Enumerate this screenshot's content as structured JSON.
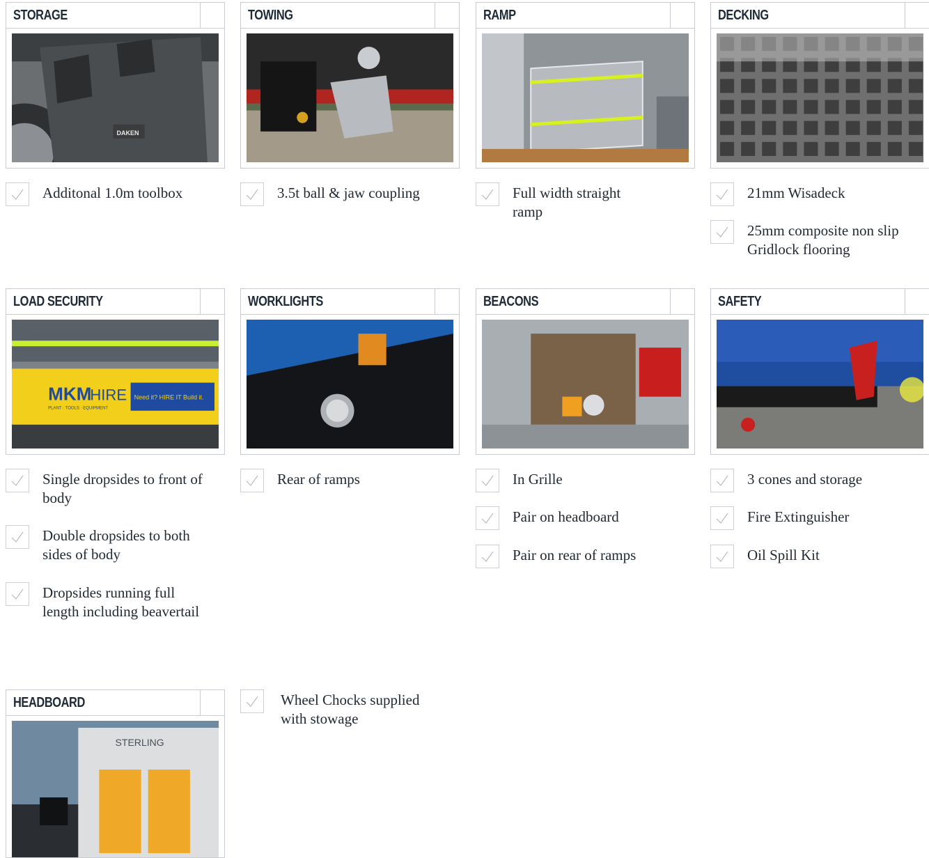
{
  "cards": [
    {
      "title": "STORAGE",
      "image": "toolbox-photo"
    },
    {
      "title": "TOWING",
      "image": "coupling-photo"
    },
    {
      "title": "RAMP",
      "image": "ramp-photo"
    },
    {
      "title": "DECKING",
      "image": "grid-decking-photo",
      "image_text": ""
    },
    {
      "title": "LOAD SECURITY",
      "image": "dropsides-photo"
    },
    {
      "title": "WORKLIGHTS",
      "image": "worklight-photo"
    },
    {
      "title": "BEACONS",
      "image": "beacons-photo"
    },
    {
      "title": "SAFETY",
      "image": "safety-photo"
    },
    {
      "title": "HEADBOARD",
      "image": "headboard-photo"
    }
  ],
  "image_labels": {
    "daken": "DAKEN",
    "mkm": "MKM",
    "hire": "HIRE",
    "need": "Need it? HIRE IT Build it.",
    "plant": "PLANT · TOOLS · EQUIPMENT",
    "sterling": "STERLING"
  },
  "features": {
    "storage": [
      "Additonal 1.0m toolbox"
    ],
    "towing": [
      "3.5t ball & jaw coupling"
    ],
    "ramp": [
      "Full width straight ramp"
    ],
    "decking": [
      "21mm Wisadeck",
      "25mm composite non slip Gridlock flooring"
    ],
    "load_security": [
      "Single dropsides to front of body",
      "Double dropsides to both sides of body",
      "Dropsides running full length including beavertail"
    ],
    "worklights": [
      "Rear of ramps"
    ],
    "beacons": [
      "In Grille",
      "Pair on headboard",
      "Pair on rear of ramps"
    ],
    "safety": [
      "3 cones and storage",
      "Fire Extinguisher",
      "Oil Spill Kit"
    ],
    "headboard": [
      "Wheel Chocks supplied with stowage"
    ]
  },
  "colors": {
    "border": "#c8cbd0",
    "title": "#1f2a38",
    "text": "#222a33",
    "check": "#b8bcc2"
  }
}
